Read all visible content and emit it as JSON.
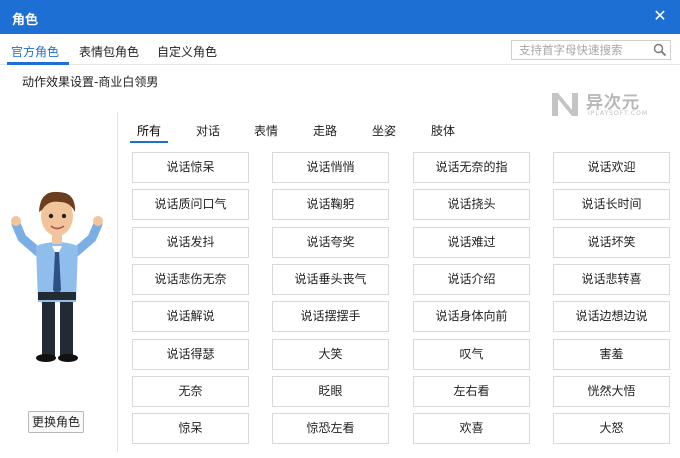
{
  "window": {
    "title": "角色",
    "close": "✕"
  },
  "tabs": [
    {
      "label": "官方角色",
      "active": true
    },
    {
      "label": "表情包角色",
      "active": false
    },
    {
      "label": "自定义角色",
      "active": false
    }
  ],
  "search": {
    "placeholder": "支持首字母快速搜索",
    "icon": "search-icon"
  },
  "subtitle": "动作效果设置-商业白领男",
  "watermark": {
    "main": "异次元",
    "sub": "IPLAYSOFT.COM"
  },
  "categories": [
    {
      "label": "所有",
      "active": true
    },
    {
      "label": "对话",
      "active": false
    },
    {
      "label": "表情",
      "active": false
    },
    {
      "label": "走路",
      "active": false
    },
    {
      "label": "坐姿",
      "active": false
    },
    {
      "label": "肢体",
      "active": false
    }
  ],
  "actions": [
    "说话惊呆",
    "说话悄悄",
    "说话无奈的指",
    "说话欢迎",
    "说话质问口气",
    "说话鞠躬",
    "说话挠头",
    "说话长时间",
    "说话发抖",
    "说话夸奖",
    "说话难过",
    "说话坏笑",
    "说话悲伤无奈",
    "说话垂头丧气",
    "说话介绍",
    "说话悲转喜",
    "说话解说",
    "说话摆摆手",
    "说话身体向前",
    "说话边想边说",
    "说话得瑟",
    "大笑",
    "叹气",
    "害羞",
    "无奈",
    "眨眼",
    "左右看",
    "恍然大悟",
    "惊呆",
    "惊恐左看",
    "欢喜",
    "大怒"
  ],
  "change_button": "更换角色",
  "colors": {
    "accent": "#1e6fd4"
  }
}
